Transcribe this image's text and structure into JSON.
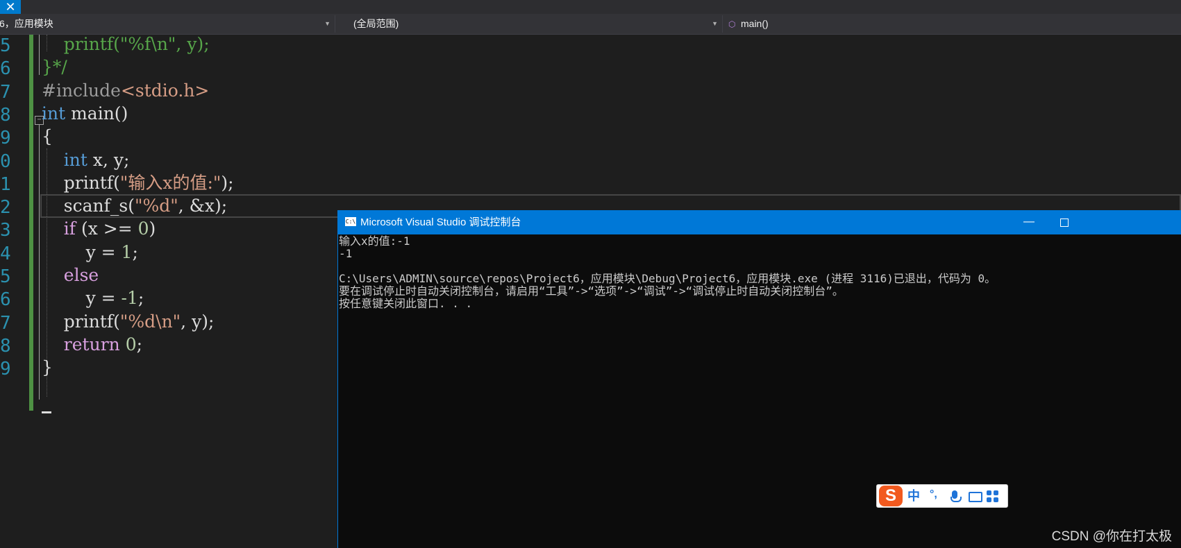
{
  "tab": {
    "close_glyph": "✕"
  },
  "nav": {
    "project": "6，应用模块",
    "scope": "(全局范围)",
    "function": "main()",
    "function_icon": "cube-icon"
  },
  "editor": {
    "line_numbers": [
      "5",
      "6",
      "7",
      "8",
      "9",
      "0",
      "1",
      "2",
      "3",
      "4",
      "5",
      "6",
      "7",
      "8",
      "9"
    ],
    "fold_glyph": "−",
    "lines": [
      [
        {
          "t": "    ",
          "c": ""
        },
        {
          "t": "printf(\"%f\\n\", y);",
          "c": "cm"
        }
      ],
      [
        {
          "t": "}*/",
          "c": "cm"
        }
      ],
      [
        {
          "t": "#include",
          "c": "pp"
        },
        {
          "t": "<stdio.h>",
          "c": "str"
        }
      ],
      [
        {
          "t": "int",
          "c": "kw"
        },
        {
          "t": " main()",
          "c": ""
        }
      ],
      [
        {
          "t": "{",
          "c": ""
        }
      ],
      [
        {
          "t": "    ",
          "c": ""
        },
        {
          "t": "int",
          "c": "kw"
        },
        {
          "t": " x, y;",
          "c": ""
        }
      ],
      [
        {
          "t": "    printf(",
          "c": ""
        },
        {
          "t": "\"输入x的值:\"",
          "c": "str"
        },
        {
          "t": ");",
          "c": ""
        }
      ],
      [
        {
          "t": "    scanf_s(",
          "c": ""
        },
        {
          "t": "\"%d\"",
          "c": "str"
        },
        {
          "t": ", &x);",
          "c": ""
        }
      ],
      [
        {
          "t": "    ",
          "c": ""
        },
        {
          "t": "if",
          "c": "kw2"
        },
        {
          "t": " (x >= ",
          "c": ""
        },
        {
          "t": "0",
          "c": "num"
        },
        {
          "t": ")",
          "c": ""
        }
      ],
      [
        {
          "t": "        y = ",
          "c": ""
        },
        {
          "t": "1",
          "c": "num"
        },
        {
          "t": ";",
          "c": ""
        }
      ],
      [
        {
          "t": "    ",
          "c": ""
        },
        {
          "t": "else",
          "c": "kw2"
        }
      ],
      [
        {
          "t": "        y = ",
          "c": ""
        },
        {
          "t": "-1",
          "c": "num"
        },
        {
          "t": ";",
          "c": ""
        }
      ],
      [
        {
          "t": "    printf(",
          "c": ""
        },
        {
          "t": "\"%d\\n\"",
          "c": "str"
        },
        {
          "t": ", y);",
          "c": ""
        }
      ],
      [
        {
          "t": "    ",
          "c": ""
        },
        {
          "t": "return",
          "c": "kw2"
        },
        {
          "t": " ",
          "c": ""
        },
        {
          "t": "0",
          "c": "num"
        },
        {
          "t": ";",
          "c": ""
        }
      ],
      [
        {
          "t": "}",
          "c": ""
        }
      ]
    ]
  },
  "console": {
    "title": "Microsoft Visual Studio 调试控制台",
    "icon": "C:\\",
    "minimize": "—",
    "lines": [
      "输入x的值:-1",
      "-1",
      "",
      "C:\\Users\\ADMIN\\source\\repos\\Project6，应用模块\\Debug\\Project6，应用模块.exe (进程 3116)已退出，代码为 0。",
      "要在调试停止时自动关闭控制台，请启用“工具”->“选项”->“调试”->“调试停止时自动关闭控制台”。",
      "按任意键关闭此窗口. . ."
    ]
  },
  "ime": {
    "logo": "S",
    "mode": "中",
    "punct": "°,",
    "icons": [
      "mic-icon",
      "keyboard-icon",
      "apps-icon"
    ]
  },
  "watermark": "CSDN @你在打太极"
}
